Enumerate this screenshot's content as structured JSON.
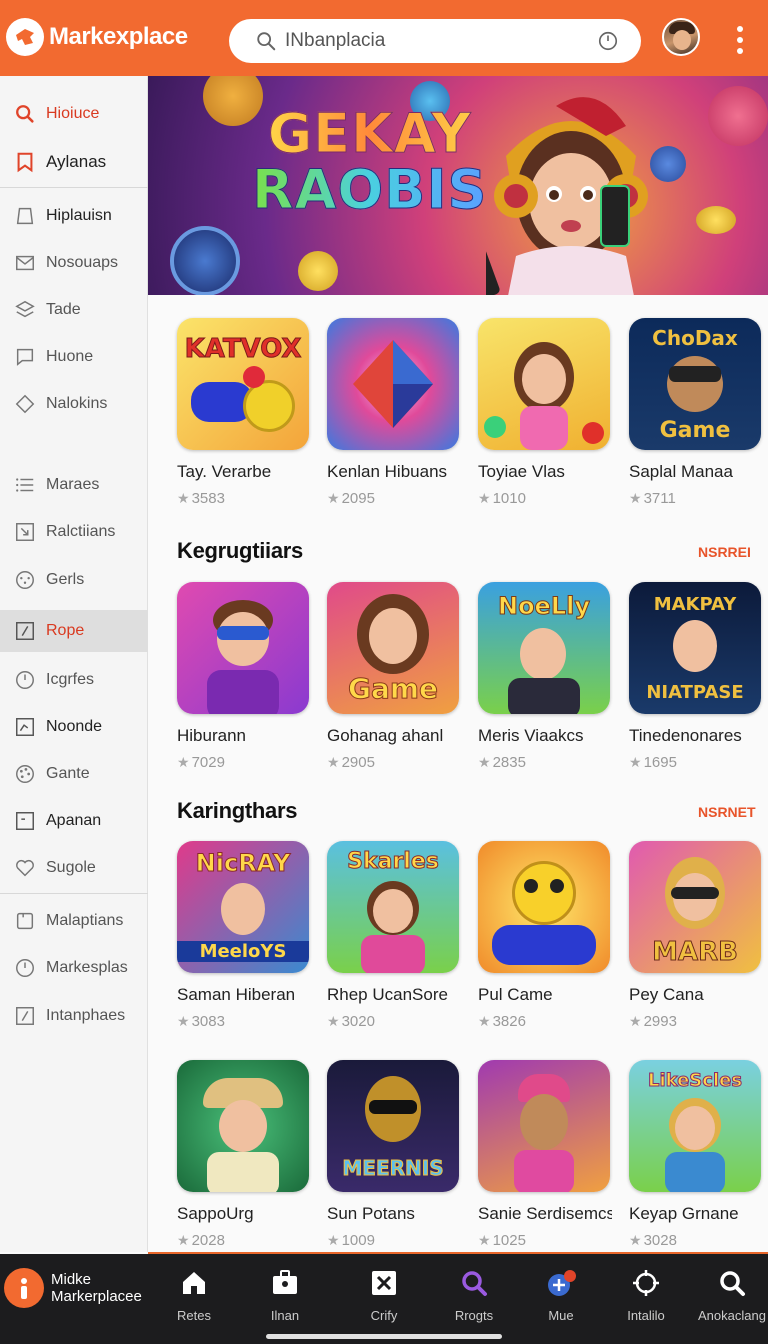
{
  "header": {
    "brand": "Markexplace",
    "search_value": "INbanplacia",
    "avatar_icon": "user-avatar",
    "menu_icon": "more-vertical-icon"
  },
  "sidebar": {
    "items": [
      {
        "label": "Hioiuce",
        "icon": "search"
      },
      {
        "label": "Aylanas",
        "icon": "bookmark"
      },
      {
        "label": "Hiplauisn",
        "icon": "tag"
      },
      {
        "label": "Nosouaps",
        "icon": "mail"
      },
      {
        "label": "Tade",
        "icon": "stack"
      },
      {
        "label": "Huone",
        "icon": "chat"
      },
      {
        "label": "Nalokins",
        "icon": "diamond"
      },
      {
        "label": "Maraes",
        "icon": "list"
      },
      {
        "label": "Ralctiians",
        "icon": "arrow-box"
      },
      {
        "label": "Gerls",
        "icon": "dots-circle"
      },
      {
        "label": "Rope",
        "icon": "edit-box"
      },
      {
        "label": "Icgrfes",
        "icon": "clock"
      },
      {
        "label": "Noonde",
        "icon": "chart-box"
      },
      {
        "label": "Gante",
        "icon": "palette"
      },
      {
        "label": "Apanan",
        "icon": "doc-box"
      },
      {
        "label": "Sugole",
        "icon": "heart"
      },
      {
        "label": "Malaptians",
        "icon": "box"
      },
      {
        "label": "Markesplas",
        "icon": "clock"
      },
      {
        "label": "Intanphaes",
        "icon": "edit-box"
      }
    ]
  },
  "banner": {
    "line1": "GEKAY",
    "line2": "RAOBIS"
  },
  "sections": [
    {
      "title": "",
      "more": "",
      "apps": [
        {
          "name": "Tay. Verarbe",
          "rating": "3583",
          "tile_text": "KATVOX",
          "bg1": "#f9d84a",
          "bg2": "#f3a43a"
        },
        {
          "name": "Kenlan Hibuans",
          "rating": "2095",
          "tile_text": "",
          "bg1": "#3aa0e0",
          "bg2": "#e04a9a"
        },
        {
          "name": "Toyiae Vlas",
          "rating": "1010",
          "tile_text": "",
          "bg1": "#f7e04a",
          "bg2": "#e0a030"
        },
        {
          "name": "Saplal Manaa",
          "rating": "3711",
          "tile_text": "ChoDax",
          "tile_text2": "Game",
          "bg1": "#0c2a5a",
          "bg2": "#1a4a8a"
        }
      ]
    },
    {
      "title": "Kegrugtiiars",
      "more": "NSRREI",
      "apps": [
        {
          "name": "Hiburann",
          "rating": "7029",
          "tile_text": "",
          "bg1": "#8a3ad0",
          "bg2": "#d04ab0"
        },
        {
          "name": "Gohanag ahanl",
          "rating": "2905",
          "tile_text": "Game",
          "bg1": "#e05a8a",
          "bg2": "#f0a040"
        },
        {
          "name": "Meris Viaakcs",
          "rating": "2835",
          "tile_text": "NoeLly",
          "bg1": "#3aa0e0",
          "bg2": "#7ad04a"
        },
        {
          "name": "Tinedenonares",
          "rating": "1695",
          "tile_text": "MAKPAY",
          "tile_text2": "NIATPASE",
          "bg1": "#0c1a3a",
          "bg2": "#1a3a6a"
        }
      ]
    },
    {
      "title": "Karingthars",
      "more": "NSRNET",
      "apps": [
        {
          "name": "Saman Hiberan",
          "rating": "3083",
          "tile_text": "NicRAY",
          "tile_text2": "MeeloYS",
          "bg1": "#e03a8a",
          "bg2": "#3a8ad0"
        },
        {
          "name": "Rhep UcanSore",
          "rating": "3020",
          "tile_text": "Skarles",
          "bg1": "#5ac0e0",
          "bg2": "#7ad04a"
        },
        {
          "name": "Pul Came",
          "rating": "3826",
          "tile_text": "",
          "bg1": "#f7d04a",
          "bg2": "#f08a2a"
        },
        {
          "name": "Pey Cana",
          "rating": "2993",
          "tile_text": "MARB",
          "bg1": "#e05ab0",
          "bg2": "#f0c040"
        }
      ]
    },
    {
      "title": "",
      "more": "",
      "apps": [
        {
          "name": "SappoUrg",
          "rating": "2028",
          "tile_text": "",
          "bg1": "#2a8a5a",
          "bg2": "#4ac07a"
        },
        {
          "name": "Sun Potans",
          "rating": "1009",
          "tile_text": "MEERNIS",
          "bg1": "#1a1a3a",
          "bg2": "#3a2a6a"
        },
        {
          "name": "Sanie Serdisemcs",
          "rating": "1025",
          "tile_text": "",
          "bg1": "#a03ab0",
          "bg2": "#f0a040"
        },
        {
          "name": "Keyap Grnane",
          "rating": "3028",
          "tile_text": "LikeScles",
          "bg1": "#7ad0e0",
          "bg2": "#7ad04a"
        }
      ]
    }
  ],
  "bottom_nav": {
    "brand_line1": "Midke",
    "brand_line2": "Markerplacee",
    "items": [
      {
        "label": "Retes",
        "icon": "home-icon"
      },
      {
        "label": "Ilnan",
        "icon": "briefcase-icon"
      },
      {
        "label": "Crify",
        "icon": "inbox-icon"
      },
      {
        "label": "Rrogts",
        "icon": "search-icon"
      },
      {
        "label": "Mue",
        "icon": "add-notification-icon"
      },
      {
        "label": "Intalilo",
        "icon": "target-icon"
      },
      {
        "label": "Anokaclang",
        "icon": "search-icon"
      }
    ]
  },
  "colors": {
    "accent": "#f26a30",
    "active_red": "#d93a20",
    "nav_bg": "#1c1c1e"
  }
}
